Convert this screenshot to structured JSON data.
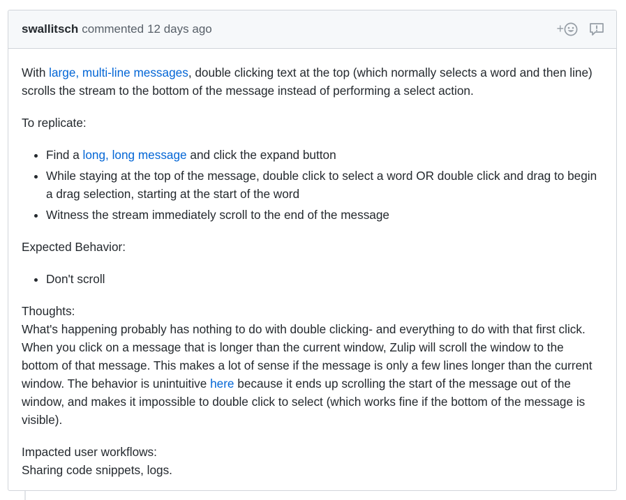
{
  "comment": {
    "author": "swallitsch",
    "action_text": "commented",
    "timestamp": "12 days ago",
    "reaction_plus": "+",
    "icons": {
      "reaction": "smiley-icon",
      "report": "report-icon"
    },
    "colors": {
      "link": "#0366d6",
      "header_bg": "#f6f8fa",
      "border": "#d1d5da",
      "text": "#24292e",
      "muted": "#586069"
    }
  },
  "body": {
    "p1": {
      "pre": "With ",
      "link": "large, multi-line messages",
      "post": ", double clicking text at the top (which normally selects a word and then line) scrolls the stream to the bottom of the message instead of performing a select action."
    },
    "replicate_heading": "To replicate:",
    "replicate_steps": [
      {
        "pre": "Find a ",
        "link": "long, long message",
        "post": " and click the expand button"
      },
      {
        "text": "While staying at the top of the message, double click to select a word OR double click and drag to begin a drag selection, starting at the start of the word"
      },
      {
        "text": "Witness the stream immediately scroll to the end of the message"
      }
    ],
    "expected_heading": "Expected Behavior:",
    "expected_items": [
      "Don't scroll"
    ],
    "thoughts": {
      "heading": "Thoughts:",
      "pre": "What's happening probably has nothing to do with double clicking- and everything to do with that first click. When you click on a message that is longer than the current window, Zulip will scroll the window to the bottom of that message. This makes a lot of sense if the message is only a few lines longer than the current window. The behavior is unintuitive ",
      "link": "here",
      "post": " because it ends up scrolling the start of the message out of the window, and makes it impossible to double click to select (which works fine if the bottom of the message is visible)."
    },
    "impacted": {
      "heading": "Impacted user workflows:",
      "text": "Sharing code snippets, logs."
    }
  }
}
